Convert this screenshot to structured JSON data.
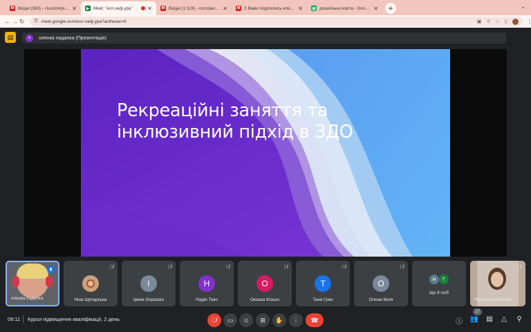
{
  "browser": {
    "tabs": [
      {
        "title": "Вхідні (963) - r.kushniryk@...",
        "favicon": "gmail-icon",
        "color": "#c5221f",
        "active": false
      },
      {
        "title": "Meet: \"evz-vadj-ypa\"",
        "favicon": "meet-icon",
        "color": "#00832d",
        "active": true
      },
      {
        "title": "Вхідні (1 519) - rocsolana@g...",
        "favicon": "gmail-icon",
        "color": "#c5221f",
        "active": false
      },
      {
        "title": "З Вами поділились електро...",
        "favicon": "gmail-icon",
        "color": "#c5221f",
        "active": false
      },
      {
        "title": "дошкільна освіта - Google Та...",
        "favicon": "sheets-icon",
        "color": "#0f9d58",
        "active": false
      }
    ],
    "url": "meet.google.com/evz-vadj-ypa?authuser=0"
  },
  "presenter": {
    "initial": "о",
    "label": "оленка падалка (Презентація)"
  },
  "slide": {
    "title_line1": "Рекреаційні заняття та",
    "title_line2": "інклюзивний підхід в ЗДО"
  },
  "participants": [
    {
      "name": "оленка падалка",
      "initial": "",
      "color": "",
      "muted": false,
      "self": true
    },
    {
      "name": "Ніна Шупарська",
      "initial": "",
      "color": "#c9a27c",
      "muted": true
    },
    {
      "name": "Ірина Опришко",
      "initial": "І",
      "color": "#7a8a9a",
      "muted": true
    },
    {
      "name": "Надія Ткач",
      "initial": "Н",
      "color": "#8430ce",
      "muted": true
    },
    {
      "name": "Оксана Юзько",
      "initial": "О",
      "color": "#d81b60",
      "muted": true
    },
    {
      "name": "Таня Грин",
      "initial": "Т",
      "color": "#1a73e8",
      "muted": true
    },
    {
      "name": "Олена Келя",
      "initial": "О",
      "color": "#7a8a9a",
      "muted": true
    },
    {
      "name": "Ще 8 осіб",
      "initial_a": "Н",
      "initial_b": "Г",
      "color_a": "#5f7a8a",
      "color_b": "#188038"
    },
    {
      "name": "Роксоляна Василі...",
      "initial": "",
      "color": "",
      "muted": true
    }
  ],
  "bottom": {
    "time": "09:11",
    "meeting_title": "Курси підвищення кваліфікації, 2 день",
    "participant_count": "17"
  },
  "icons": {
    "mic_off": "mic-off-icon",
    "camera": "camera-icon",
    "emoji": "emoji-icon",
    "present": "present-screen-icon",
    "hand": "raise-hand-icon",
    "more": "more-options-icon",
    "leave": "leave-call-icon",
    "info": "info-icon",
    "people": "people-icon",
    "chat": "chat-icon",
    "activities": "activities-icon",
    "host": "host-controls-icon"
  }
}
